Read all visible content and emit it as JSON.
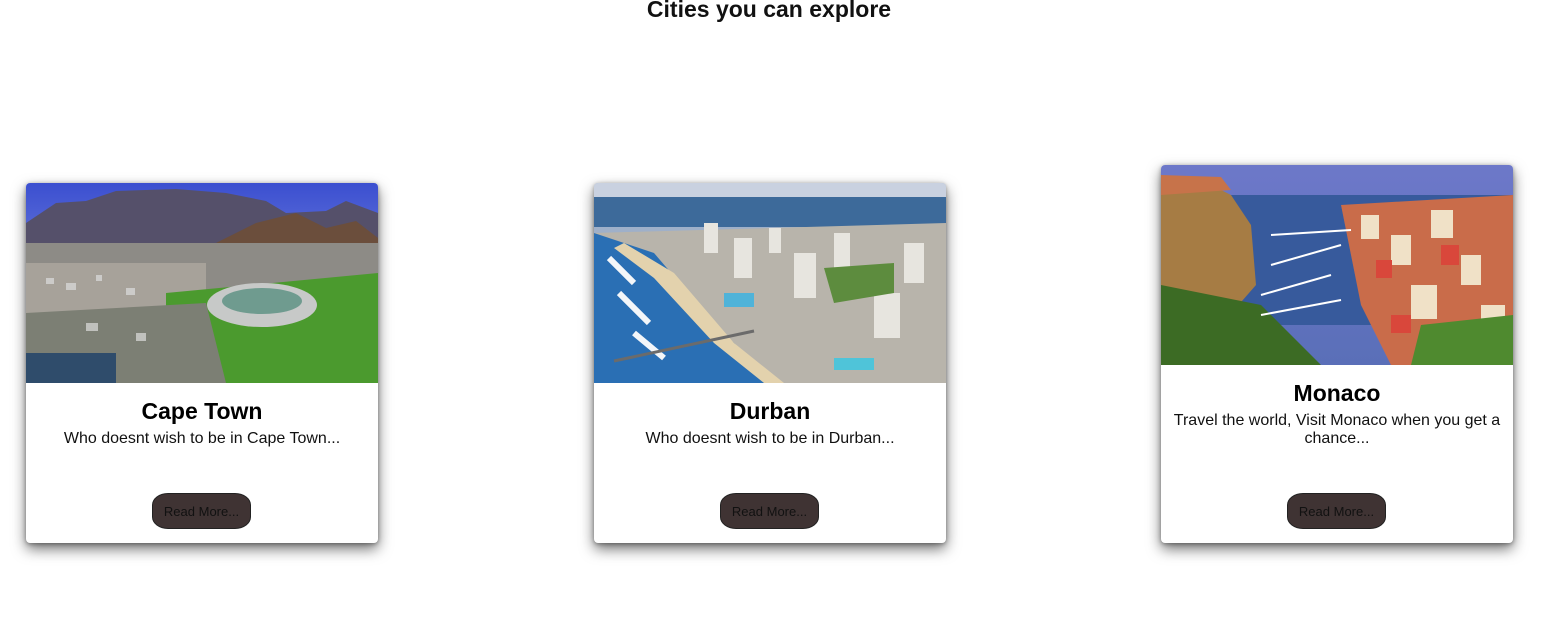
{
  "page": {
    "title": "Cities you can explore"
  },
  "cards": [
    {
      "title": "Cape Town",
      "text": "Who doesnt wish to be in Cape Town...",
      "button_label": "Read More..."
    },
    {
      "title": "Durban",
      "text": "Who doesnt wish to be in Durban...",
      "button_label": "Read More..."
    },
    {
      "title": "Monaco",
      "text": "Travel the world, Visit Monaco when you get a chance...",
      "button_label": "Read More..."
    }
  ],
  "colors": {
    "button_bg": "#3f3333",
    "card_bg": "#ffffff"
  }
}
